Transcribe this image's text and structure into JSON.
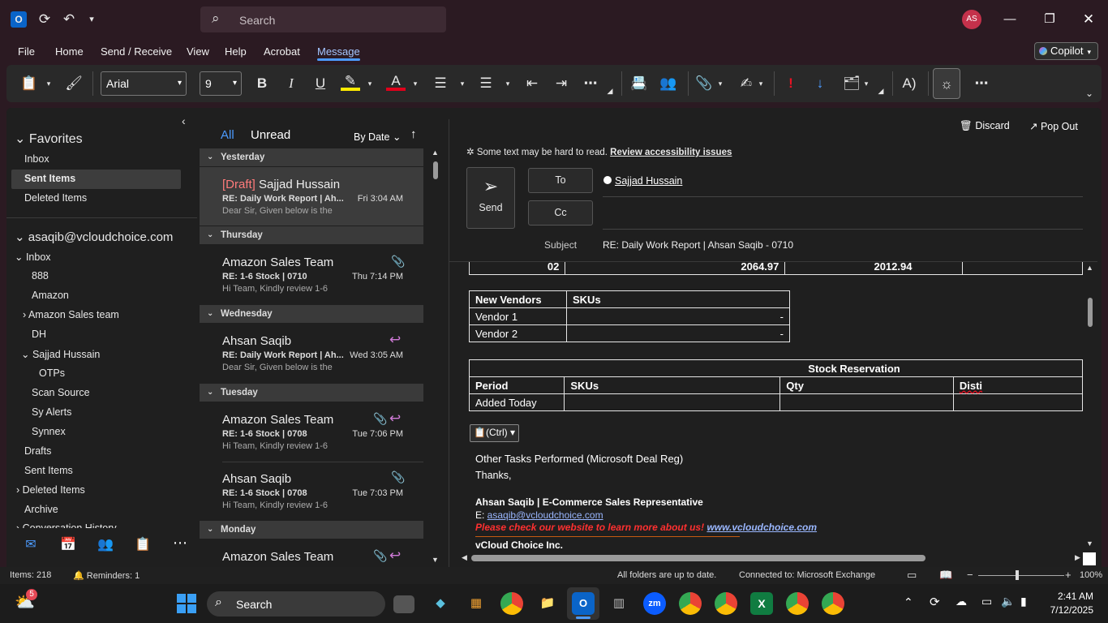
{
  "titlebar": {
    "search_placeholder": "Search",
    "avatar_initials": "AS"
  },
  "menu": [
    "File",
    "Home",
    "Send / Receive",
    "View",
    "Help",
    "Acrobat",
    "Message"
  ],
  "copilot_label": "Copilot",
  "ribbon": {
    "font": "Arial",
    "size": "9"
  },
  "nav": {
    "favorites_label": "Favorites",
    "favorites": [
      "Inbox",
      "Sent Items",
      "Deleted Items"
    ],
    "account": "asaqib@vcloudchoice.com",
    "inbox_label": "Inbox",
    "inbox_children": [
      "888",
      "Amazon",
      "Amazon Sales team",
      "DH",
      "Sajjad Hussain"
    ],
    "otps": "OTPs",
    "inbox_more": [
      "Scan Source",
      "Sy Alerts",
      "Synnex"
    ],
    "folders": [
      "Drafts",
      "Sent Items",
      "Deleted Items",
      "Archive",
      "Conversation History"
    ]
  },
  "list": {
    "tab_all": "All",
    "tab_unread": "Unread",
    "sort": "By Date",
    "groups": [
      "Yesterday",
      "Thursday",
      "Wednesday",
      "Tuesday",
      "Monday"
    ],
    "messages": [
      {
        "draft": "[Draft]",
        "from": "Sajjad Hussain",
        "subject": "RE: Daily Work Report | Ah...",
        "time": "Fri 3:04 AM",
        "preview": "Dear Sir,  Given below is the"
      },
      {
        "from": "Amazon Sales Team",
        "subject": "RE: 1-6 Stock | 0710",
        "time": "Thu 7:14 PM",
        "preview": "Hi Team,  Kindly review 1-6"
      },
      {
        "from": "Ahsan Saqib",
        "subject": "RE: Daily Work Report | Ah...",
        "time": "Wed 3:05 AM",
        "preview": "Dear Sir,  Given below is the"
      },
      {
        "from": "Amazon Sales Team",
        "subject": "RE: 1-6 Stock | 0708",
        "time": "Tue 7:06 PM",
        "preview": "Hi Team,  Kindly review 1-6"
      },
      {
        "from": "Ahsan Saqib",
        "subject": "RE: 1-6 Stock | 0708",
        "time": "Tue 7:03 PM",
        "preview": "Hi Team,  Kindly review 1-6"
      },
      {
        "from": "Amazon Sales Team"
      }
    ]
  },
  "reading": {
    "discard": "Discard",
    "popout": "Pop Out",
    "accessibility_note": "Some text may be hard to read.",
    "accessibility_link": "Review accessibility issues",
    "send": "Send",
    "to_label": "To",
    "cc_label": "Cc",
    "to_recipient": "Sajjad Hussain",
    "subject_label": "Subject",
    "subject_value": "RE: Daily Work Report | Ahsan Saqib - 0710",
    "top_row": [
      "02",
      "2064.97",
      "2012.94"
    ],
    "vendors_header": [
      "New Vendors",
      "SKUs"
    ],
    "vendors": [
      [
        "Vendor 1",
        "-"
      ],
      [
        "Vendor 2",
        "-"
      ]
    ],
    "reservation_title": "Stock Reservation",
    "reservation_header": [
      "Period",
      "SKUs",
      "Qty",
      "Disti"
    ],
    "reservation_rows": [
      [
        "Added Today",
        "",
        "",
        ""
      ]
    ],
    "paste_ctrl": "(Ctrl)",
    "other_tasks": "Other Tasks Performed (Microsoft Deal Reg)",
    "thanks": "Thanks,",
    "sig_name": "Ahsan Saqib | E-Commerce Sales Representative",
    "sig_email_label": "E: ",
    "sig_email": "asaqib@vcloudchoice.com",
    "sig_website_text": "Please check our website to learn more about us!",
    "sig_website": "www.vcloudchoice.com",
    "sig_company": "vCloud Choice Inc."
  },
  "status": {
    "items": "Items: 218",
    "reminders": "Reminders: 1",
    "sync": "All folders are up to date.",
    "connection": "Connected to: Microsoft Exchange",
    "zoom": "100%"
  },
  "taskbar": {
    "search": "Search",
    "weather_badge": "5",
    "time": "2:41 AM",
    "date": "7/12/2025"
  }
}
